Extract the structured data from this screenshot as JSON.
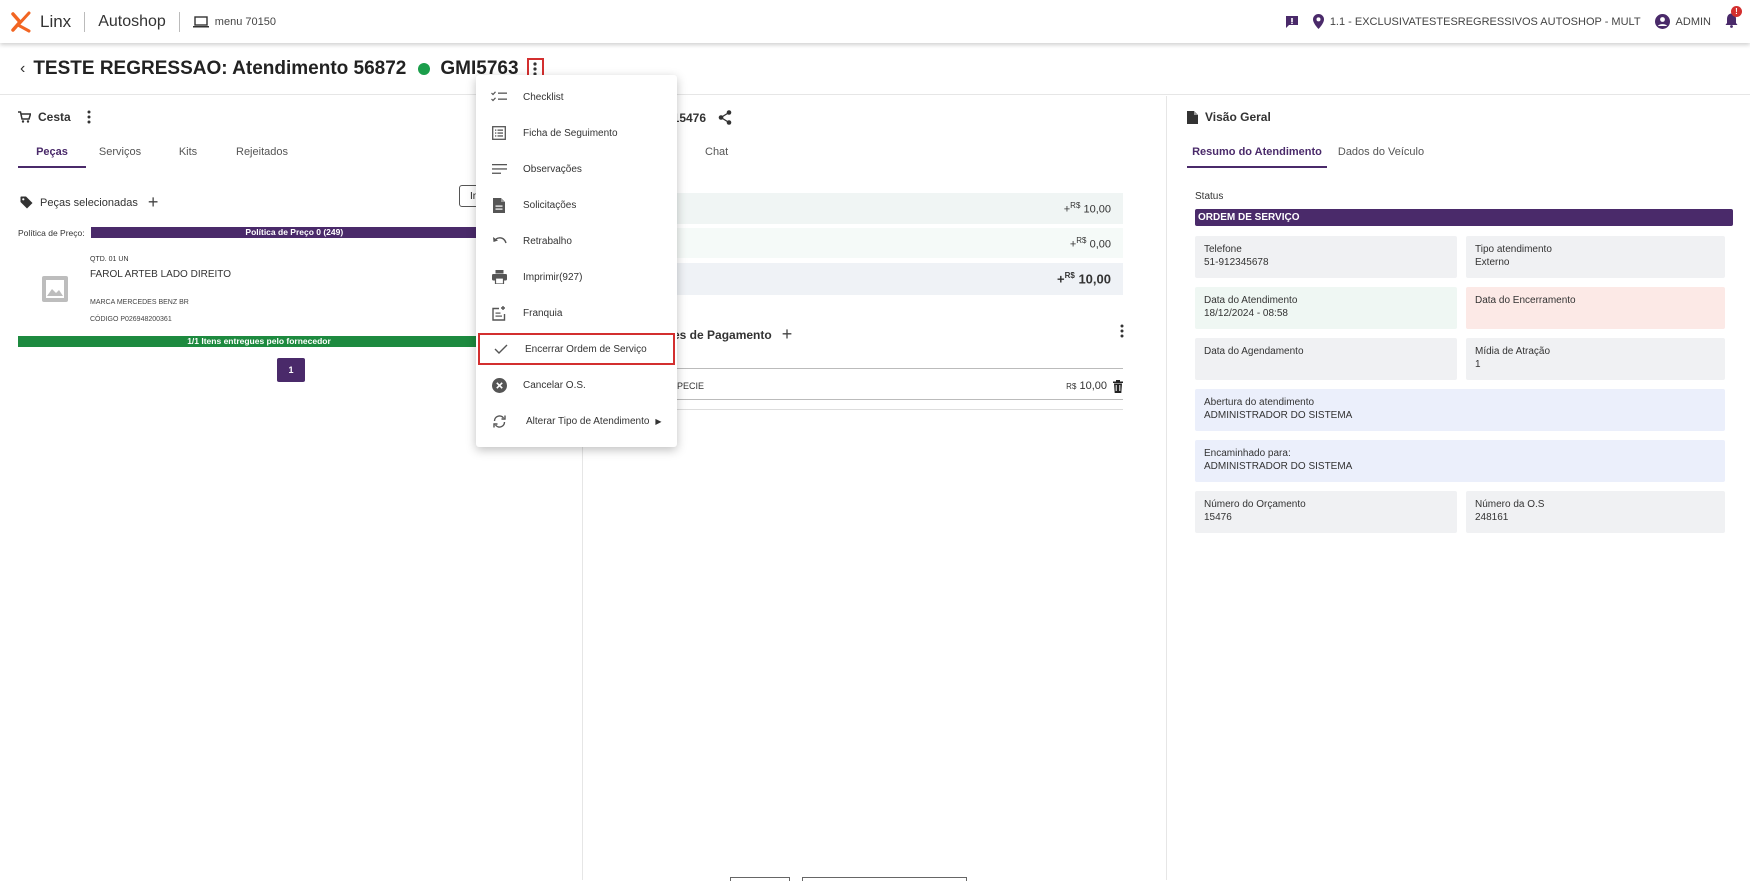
{
  "header": {
    "brand": "Linx",
    "product": "Autoshop",
    "menu_label": "menu 70150",
    "location": "1.1 - EXCLUSIVATESTESREGRESSIVOS AUTOSHOP - MULT",
    "user": "ADMIN",
    "notif_badge": "!"
  },
  "title": {
    "text": "TESTE REGRESSAO: Atendimento 56872",
    "plate": "GMI5763",
    "status_color": "#1b9e4b"
  },
  "cesta": {
    "title": "Cesta",
    "tabs": [
      "Peças",
      "Serviços",
      "Kits",
      "Rejeitados"
    ],
    "pecas_label": "Peças selecionadas",
    "insert_label": "In",
    "politica_label": "Política de Preço:",
    "politica_value": "Política de Preço 0 (249)",
    "item": {
      "qtd": "QTD. 01 UN",
      "name": "FAROL ARTEB LADO DIREITO",
      "marca": "MARCA   MERCEDES BENZ BR",
      "codigo": "CÓDIGO   P026948200361"
    },
    "entregues": "1/1 Itens entregues pelo fornecedor",
    "page": "1"
  },
  "orcamento": {
    "title": "o: 15476",
    "chat_tab": "Chat",
    "currency": "R$",
    "totals": [
      "10,00",
      "0,00",
      "10,00"
    ],
    "pagamento_title": "es de Pagamento",
    "pagamento_item": "SPECIE",
    "pagamento_value": "10,00"
  },
  "visao": {
    "title": "Visão Geral",
    "tabs": [
      "Resumo do Atendimento",
      "Dados do Veículo"
    ],
    "status_label": "Status",
    "status_value": "ORDEM DE SERVIÇO",
    "telefone_l": "Telefone",
    "telefone_v": "51-912345678",
    "tipo_l": "Tipo atendimento",
    "tipo_v": "Externo",
    "data_at_l": "Data do Atendimento",
    "data_at_v": "18/12/2024 - 08:58",
    "data_enc_l": "Data do Encerramento",
    "data_ag_l": "Data do Agendamento",
    "midia_l": "Mídia de Atração",
    "midia_v": "1",
    "abertura_l": "Abertura do atendimento",
    "abertura_v": "ADMINISTRADOR DO SISTEMA",
    "encaminhado_l": "Encaminhado para:",
    "encaminhado_v": "ADMINISTRADOR DO SISTEMA",
    "num_orc_l": "Número do Orçamento",
    "num_orc_v": "15476",
    "num_os_l": "Número da O.S",
    "num_os_v": "248161"
  },
  "menu": {
    "items": [
      "Checklist",
      "Ficha de Seguimento",
      "Observações",
      "Solicitações",
      "Retrabalho",
      "Imprimir(927)",
      "Franquia",
      "Encerrar Ordem de Serviço",
      "Cancelar O.S.",
      "Alterar Tipo de Atendimento"
    ]
  },
  "colors": {
    "primary": "#4a2a6a",
    "success": "#1d8a3f",
    "danger": "#d32f2f"
  }
}
